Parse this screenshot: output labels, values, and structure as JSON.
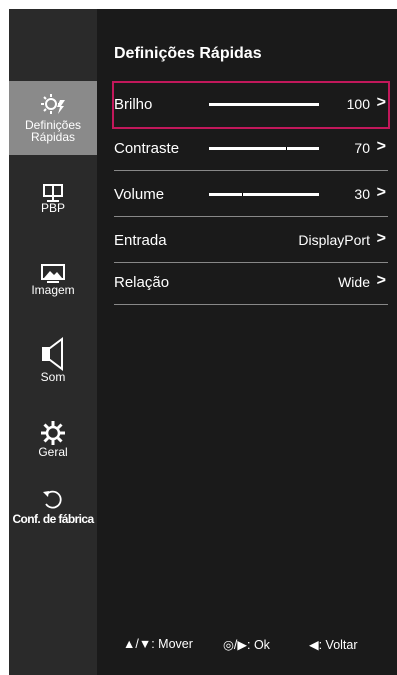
{
  "sidebar": {
    "items": [
      {
        "label_line1": "Definições",
        "label_line2": "Rápidas",
        "icon": "quick-settings-icon"
      },
      {
        "label": "PBP",
        "icon": "pbp-icon"
      },
      {
        "label": "Imagem",
        "icon": "picture-icon"
      },
      {
        "label": "Som",
        "icon": "speaker-icon"
      },
      {
        "label": "Geral",
        "icon": "gear-icon"
      },
      {
        "label": "Conf. de fábrica",
        "icon": "reset-icon"
      }
    ]
  },
  "main": {
    "title": "Definições Rápidas",
    "rows": [
      {
        "label": "Brilho",
        "value": "100",
        "level": 100
      },
      {
        "label": "Contraste",
        "value": "70",
        "level": 70
      },
      {
        "label": "Volume",
        "value": "30",
        "level": 30
      },
      {
        "label": "Entrada",
        "value": "DisplayPort"
      },
      {
        "label": "Relação",
        "value": "Wide"
      }
    ],
    "chevron": ">"
  },
  "footer": {
    "move_label": "▲/▼: Mover",
    "ok_label": "◎/▶: Ok",
    "back_label": "◀: Voltar"
  },
  "colors": {
    "selection": "#c2185b",
    "active_sidebar": "#8a8a8a",
    "background": "#1a1a1a"
  }
}
